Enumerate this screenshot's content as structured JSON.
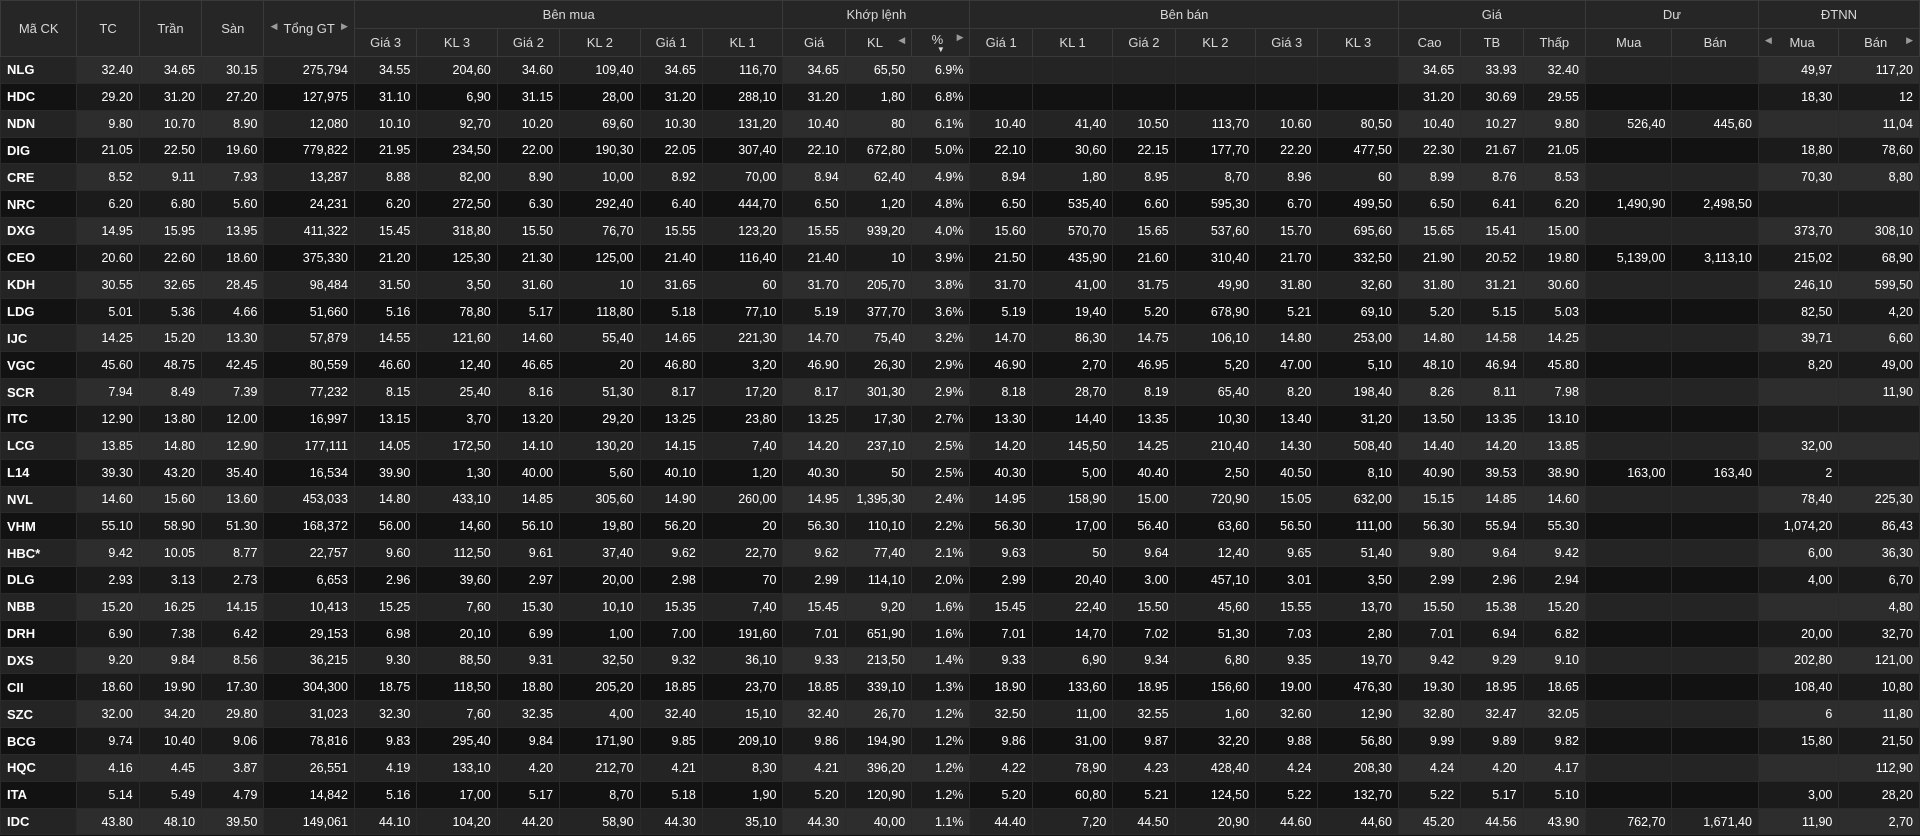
{
  "colors": {
    "ref": "#f5d10a",
    "ceil": "#e65bf5",
    "floor": "#4fd9f0",
    "up": "#1edc1e",
    "down": "#ff3b3b",
    "white": "#ffffff"
  },
  "header": {
    "symbol": "Mã CK",
    "ref": "TC",
    "ceil": "Trần",
    "floor": "Sàn",
    "total": "Tổng GT",
    "bid_group": "Bên mua",
    "match_group": "Khớp lệnh",
    "ask_group": "Bên bán",
    "price_group": "Giá",
    "rest_group": "Dư",
    "foreign_group": "ĐTNN",
    "bid_cols": [
      "Giá 3",
      "KL 3",
      "Giá 2",
      "KL 2",
      "Giá 1",
      "KL 1"
    ],
    "match_cols": [
      "Giá",
      "KL",
      "%"
    ],
    "ask_cols": [
      "Giá 1",
      "KL 1",
      "Giá 2",
      "KL 2",
      "Giá 3",
      "KL 3"
    ],
    "price_cols": [
      "Cao",
      "TB",
      "Thấp"
    ],
    "rest_cols": [
      "Mua",
      "Bán"
    ],
    "foreign_cols": [
      "Mua",
      "Bán"
    ]
  },
  "rows": [
    {
      "sym": "NLG",
      "tc": "32.40",
      "tran": "34.65",
      "san": "30.15",
      "gt": "275,794",
      "b3": "34.55",
      "bk3": "204,60",
      "b2": "34.60",
      "bk2": "109,40",
      "b1": "34.65",
      "bk1": "116,70",
      "mp": "34.65",
      "mk": "65,50",
      "pct": "6.9%",
      "a1": "",
      "ak1": "",
      "a2": "",
      "ak2": "",
      "a3": "",
      "ak3": "",
      "cao": "34.65",
      "tb": "33.93",
      "thap": "32.40",
      "dm": "",
      "db": "",
      "fm": "49,97",
      "fb": "117,20",
      "c": "cecceccccccccccccccxxxxxxcur"
    },
    {
      "sym": "HDC",
      "tc": "29.20",
      "tran": "31.20",
      "san": "27.20",
      "gt": "127,975",
      "b3": "31.10",
      "bk3": "6,90",
      "b2": "31.15",
      "bk2": "28,00",
      "b1": "31.20",
      "bk1": "288,10",
      "mp": "31.20",
      "mk": "1,80",
      "pct": "6.8%",
      "a1": "",
      "ak1": "",
      "a2": "",
      "ak2": "",
      "a3": "",
      "ak3": "",
      "cao": "31.20",
      "tb": "30.69",
      "thap": "29.55",
      "dm": "",
      "db": "",
      "fm": "18,30",
      "fb": "12",
      "c": "crcfwuuuucccccccxxxxxxcuu"
    },
    {
      "sym": "NDN",
      "tc": "9.80",
      "tran": "10.70",
      "san": "8.90",
      "gt": "12,080",
      "b3": "10.10",
      "bk3": "92,70",
      "b2": "10.20",
      "bk2": "69,60",
      "b1": "10.30",
      "bk1": "131,20",
      "mp": "10.40",
      "mk": "80",
      "pct": "6.1%",
      "a1": "10.40",
      "ak1": "41,40",
      "a2": "10.50",
      "ak2": "113,70",
      "a3": "10.60",
      "ak3": "80,50",
      "cao": "10.40",
      "tb": "10.27",
      "thap": "9.80",
      "dm": "526,40",
      "db": "445,60",
      "fm": "",
      "fb": "11,04",
      "c": "u"
    },
    {
      "sym": "DIG",
      "tc": "21.05",
      "tran": "22.50",
      "san": "19.60",
      "gt": "779,822",
      "b3": "21.95",
      "bk3": "234,50",
      "b2": "22.00",
      "bk2": "190,30",
      "b1": "22.05",
      "bk1": "307,40",
      "mp": "22.10",
      "mk": "672,80",
      "pct": "5.0%",
      "a1": "22.10",
      "ak1": "30,60",
      "a2": "22.15",
      "ak2": "177,70",
      "a3": "22.20",
      "ak3": "477,50",
      "cao": "22.30",
      "tb": "21.67",
      "thap": "21.05",
      "dm": "",
      "db": "",
      "fm": "18,80",
      "fb": "78,60",
      "c": "u"
    },
    {
      "sym": "CRE",
      "tc": "8.52",
      "tran": "9.11",
      "san": "7.93",
      "gt": "13,287",
      "b3": "8.88",
      "bk3": "82,00",
      "b2": "8.90",
      "bk2": "10,00",
      "b1": "8.92",
      "bk1": "70,00",
      "mp": "8.94",
      "mk": "62,40",
      "pct": "4.9%",
      "a1": "8.94",
      "ak1": "1,80",
      "a2": "8.95",
      "ak2": "8,70",
      "a3": "8.96",
      "ak3": "60",
      "cao": "8.99",
      "tb": "8.76",
      "thap": "8.53",
      "dm": "",
      "db": "",
      "fm": "70,30",
      "fb": "8,80",
      "c": "u"
    },
    {
      "sym": "NRC",
      "tc": "6.20",
      "tran": "6.80",
      "san": "5.60",
      "gt": "24,231",
      "b3": "6.20",
      "bk3": "272,50",
      "b2": "6.30",
      "bk2": "292,40",
      "b1": "6.40",
      "bk1": "444,70",
      "mp": "6.50",
      "mk": "1,20",
      "pct": "4.8%",
      "a1": "6.50",
      "ak1": "535,40",
      "a2": "6.60",
      "ak2": "595,30",
      "a3": "6.70",
      "ak3": "499,50",
      "cao": "6.50",
      "tb": "6.41",
      "thap": "6.20",
      "dm": "1,490,90",
      "db": "2,498,50",
      "fm": "",
      "fb": "",
      "c": "u",
      "b3c": "ref",
      "bk3c": "ref",
      "thapc": "ref"
    },
    {
      "sym": "DXG",
      "tc": "14.95",
      "tran": "15.95",
      "san": "13.95",
      "gt": "411,322",
      "b3": "15.45",
      "bk3": "318,80",
      "b2": "15.50",
      "bk2": "76,70",
      "b1": "15.55",
      "bk1": "123,20",
      "mp": "15.55",
      "mk": "939,20",
      "pct": "4.0%",
      "a1": "15.60",
      "ak1": "570,70",
      "a2": "15.65",
      "ak2": "537,60",
      "a3": "15.70",
      "ak3": "695,60",
      "cao": "15.65",
      "tb": "15.41",
      "thap": "15.00",
      "dm": "",
      "db": "",
      "fm": "373,70",
      "fb": "308,10",
      "c": "u"
    },
    {
      "sym": "CEO",
      "tc": "20.60",
      "tran": "22.60",
      "san": "18.60",
      "gt": "375,330",
      "b3": "21.20",
      "bk3": "125,30",
      "b2": "21.30",
      "bk2": "125,00",
      "b1": "21.40",
      "bk1": "116,40",
      "mp": "21.40",
      "mk": "10",
      "pct": "3.9%",
      "a1": "21.50",
      "ak1": "435,90",
      "a2": "21.60",
      "ak2": "310,40",
      "a3": "21.70",
      "ak3": "332,50",
      "cao": "21.90",
      "tb": "20.52",
      "thap": "19.80",
      "dm": "5,139,00",
      "db": "3,113,10",
      "fm": "215,02",
      "fb": "68,90",
      "c": "u",
      "tbc": "down",
      "thapc": "down"
    },
    {
      "sym": "KDH",
      "tc": "30.55",
      "tran": "32.65",
      "san": "28.45",
      "gt": "98,484",
      "b3": "31.50",
      "bk3": "3,50",
      "b2": "31.60",
      "bk2": "10",
      "b1": "31.65",
      "bk1": "60",
      "mp": "31.70",
      "mk": "205,70",
      "pct": "3.8%",
      "a1": "31.70",
      "ak1": "41,00",
      "a2": "31.75",
      "ak2": "49,90",
      "a3": "31.80",
      "ak3": "32,60",
      "cao": "31.80",
      "tb": "31.21",
      "thap": "30.60",
      "dm": "",
      "db": "",
      "fm": "246,10",
      "fb": "599,50",
      "c": "u"
    },
    {
      "sym": "LDG",
      "tc": "5.01",
      "tran": "5.36",
      "san": "4.66",
      "gt": "51,660",
      "b3": "5.16",
      "bk3": "78,80",
      "b2": "5.17",
      "bk2": "118,80",
      "b1": "5.18",
      "bk1": "77,10",
      "mp": "5.19",
      "mk": "377,70",
      "pct": "3.6%",
      "a1": "5.19",
      "ak1": "19,40",
      "a2": "5.20",
      "ak2": "678,90",
      "a3": "5.21",
      "ak3": "69,10",
      "cao": "5.20",
      "tb": "5.15",
      "thap": "5.03",
      "dm": "",
      "db": "",
      "fm": "82,50",
      "fb": "4,20",
      "c": "u"
    },
    {
      "sym": "IJC",
      "tc": "14.25",
      "tran": "15.20",
      "san": "13.30",
      "gt": "57,879",
      "b3": "14.55",
      "bk3": "121,60",
      "b2": "14.60",
      "bk2": "55,40",
      "b1": "14.65",
      "bk1": "221,30",
      "mp": "14.70",
      "mk": "75,40",
      "pct": "3.2%",
      "a1": "14.70",
      "ak1": "86,30",
      "a2": "14.75",
      "ak2": "106,10",
      "a3": "14.80",
      "ak3": "253,00",
      "cao": "14.80",
      "tb": "14.58",
      "thap": "14.25",
      "dm": "",
      "db": "",
      "fm": "39,71",
      "fb": "6,60",
      "c": "u",
      "thapc": "ref"
    },
    {
      "sym": "VGC",
      "tc": "45.60",
      "tran": "48.75",
      "san": "42.45",
      "gt": "80,559",
      "b3": "46.60",
      "bk3": "12,40",
      "b2": "46.65",
      "bk2": "20",
      "b1": "46.80",
      "bk1": "3,20",
      "mp": "46.90",
      "mk": "26,30",
      "pct": "2.9%",
      "a1": "46.90",
      "ak1": "2,70",
      "a2": "46.95",
      "ak2": "5,20",
      "a3": "47.00",
      "ak3": "5,10",
      "cao": "48.10",
      "tb": "46.94",
      "thap": "45.80",
      "dm": "",
      "db": "",
      "fm": "8,20",
      "fb": "49,00",
      "c": "u"
    },
    {
      "sym": "SCR",
      "tc": "7.94",
      "tran": "8.49",
      "san": "7.39",
      "gt": "77,232",
      "b3": "8.15",
      "bk3": "25,40",
      "b2": "8.16",
      "bk2": "51,30",
      "b1": "8.17",
      "bk1": "17,20",
      "mp": "8.17",
      "mk": "301,30",
      "pct": "2.9%",
      "a1": "8.18",
      "ak1": "28,70",
      "a2": "8.19",
      "ak2": "65,40",
      "a3": "8.20",
      "ak3": "198,40",
      "cao": "8.26",
      "tb": "8.11",
      "thap": "7.98",
      "dm": "",
      "db": "",
      "fm": "",
      "fb": "11,90",
      "c": "u"
    },
    {
      "sym": "ITC",
      "tc": "12.90",
      "tran": "13.80",
      "san": "12.00",
      "gt": "16,997",
      "b3": "13.15",
      "bk3": "3,70",
      "b2": "13.20",
      "bk2": "29,20",
      "b1": "13.25",
      "bk1": "23,80",
      "mp": "13.25",
      "mk": "17,30",
      "pct": "2.7%",
      "a1": "13.30",
      "ak1": "14,40",
      "a2": "13.35",
      "ak2": "10,30",
      "a3": "13.40",
      "ak3": "31,20",
      "cao": "13.50",
      "tb": "13.35",
      "thap": "13.10",
      "dm": "",
      "db": "",
      "fm": "",
      "fb": "",
      "c": "u"
    },
    {
      "sym": "LCG",
      "tc": "13.85",
      "tran": "14.80",
      "san": "12.90",
      "gt": "177,111",
      "b3": "14.05",
      "bk3": "172,50",
      "b2": "14.10",
      "bk2": "130,20",
      "b1": "14.15",
      "bk1": "7,40",
      "mp": "14.20",
      "mk": "237,10",
      "pct": "2.5%",
      "a1": "14.20",
      "ak1": "145,50",
      "a2": "14.25",
      "ak2": "210,40",
      "a3": "14.30",
      "ak3": "508,40",
      "cao": "14.40",
      "tb": "14.20",
      "thap": "13.85",
      "dm": "",
      "db": "",
      "fm": "32,00",
      "fb": "",
      "c": "u",
      "thapc": "ref"
    },
    {
      "sym": "L14",
      "tc": "39.30",
      "tran": "43.20",
      "san": "35.40",
      "gt": "16,534",
      "b3": "39.90",
      "bk3": "1,30",
      "b2": "40.00",
      "bk2": "5,60",
      "b1": "40.10",
      "bk1": "1,20",
      "mp": "40.30",
      "mk": "50",
      "pct": "2.5%",
      "a1": "40.30",
      "ak1": "5,00",
      "a2": "40.40",
      "ak2": "2,50",
      "a3": "40.50",
      "ak3": "8,10",
      "cao": "40.90",
      "tb": "39.53",
      "thap": "38.90",
      "dm": "163,00",
      "db": "163,40",
      "fm": "2",
      "fb": "",
      "c": "u",
      "thapc": "down"
    },
    {
      "sym": "NVL",
      "tc": "14.60",
      "tran": "15.60",
      "san": "13.60",
      "gt": "453,033",
      "b3": "14.80",
      "bk3": "433,10",
      "b2": "14.85",
      "bk2": "305,60",
      "b1": "14.90",
      "bk1": "260,00",
      "mp": "14.95",
      "mk": "1,395,30",
      "pct": "2.4%",
      "a1": "14.95",
      "ak1": "158,90",
      "a2": "15.00",
      "ak2": "720,90",
      "a3": "15.05",
      "ak3": "632,00",
      "cao": "15.15",
      "tb": "14.85",
      "thap": "14.60",
      "dm": "",
      "db": "",
      "fm": "78,40",
      "fb": "225,30",
      "c": "u",
      "thapc": "ref"
    },
    {
      "sym": "VHM",
      "tc": "55.10",
      "tran": "58.90",
      "san": "51.30",
      "gt": "168,372",
      "b3": "56.00",
      "bk3": "14,60",
      "b2": "56.10",
      "bk2": "19,80",
      "b1": "56.20",
      "bk1": "20",
      "mp": "56.30",
      "mk": "110,10",
      "pct": "2.2%",
      "a1": "56.30",
      "ak1": "17,00",
      "a2": "56.40",
      "ak2": "63,60",
      "a3": "56.50",
      "ak3": "111,00",
      "cao": "56.30",
      "tb": "55.94",
      "thap": "55.30",
      "dm": "",
      "db": "",
      "fm": "1,074,20",
      "fb": "86,43",
      "c": "u"
    },
    {
      "sym": "HBC*",
      "tc": "9.42",
      "tran": "10.05",
      "san": "8.77",
      "gt": "22,757",
      "b3": "9.60",
      "bk3": "112,50",
      "b2": "9.61",
      "bk2": "37,40",
      "b1": "9.62",
      "bk1": "22,70",
      "mp": "9.62",
      "mk": "77,40",
      "pct": "2.1%",
      "a1": "9.63",
      "ak1": "50",
      "a2": "9.64",
      "ak2": "12,40",
      "a3": "9.65",
      "ak3": "51,40",
      "cao": "9.80",
      "tb": "9.64",
      "thap": "9.42",
      "dm": "",
      "db": "",
      "fm": "6,00",
      "fb": "36,30",
      "c": "u",
      "thapc": "ref"
    },
    {
      "sym": "DLG",
      "tc": "2.93",
      "tran": "3.13",
      "san": "2.73",
      "gt": "6,653",
      "b3": "2.96",
      "bk3": "39,60",
      "b2": "2.97",
      "bk2": "20,00",
      "b1": "2.98",
      "bk1": "70",
      "mp": "2.99",
      "mk": "114,10",
      "pct": "2.0%",
      "a1": "2.99",
      "ak1": "20,40",
      "a2": "3.00",
      "ak2": "457,10",
      "a3": "3.01",
      "ak3": "3,50",
      "cao": "2.99",
      "tb": "2.96",
      "thap": "2.94",
      "dm": "",
      "db": "",
      "fm": "4,00",
      "fb": "6,70",
      "c": "u"
    },
    {
      "sym": "NBB",
      "tc": "15.20",
      "tran": "16.25",
      "san": "14.15",
      "gt": "10,413",
      "b3": "15.25",
      "bk3": "7,60",
      "b2": "15.30",
      "bk2": "10,10",
      "b1": "15.35",
      "bk1": "7,40",
      "mp": "15.45",
      "mk": "9,20",
      "pct": "1.6%",
      "a1": "15.45",
      "ak1": "22,40",
      "a2": "15.50",
      "ak2": "45,60",
      "a3": "15.55",
      "ak3": "13,70",
      "cao": "15.50",
      "tb": "15.38",
      "thap": "15.20",
      "dm": "",
      "db": "",
      "fm": "",
      "fb": "4,80",
      "c": "u",
      "thapc": "ref"
    },
    {
      "sym": "DRH",
      "tc": "6.90",
      "tran": "7.38",
      "san": "6.42",
      "gt": "29,153",
      "b3": "6.98",
      "bk3": "20,10",
      "b2": "6.99",
      "bk2": "1,00",
      "b1": "7.00",
      "bk1": "191,60",
      "mp": "7.01",
      "mk": "651,90",
      "pct": "1.6%",
      "a1": "7.01",
      "ak1": "14,70",
      "a2": "7.02",
      "ak2": "51,30",
      "a3": "7.03",
      "ak3": "2,80",
      "cao": "7.01",
      "tb": "6.94",
      "thap": "6.82",
      "dm": "",
      "db": "",
      "fm": "20,00",
      "fb": "32,70",
      "c": "u",
      "thapc": "down"
    },
    {
      "sym": "DXS",
      "tc": "9.20",
      "tran": "9.84",
      "san": "8.56",
      "gt": "36,215",
      "b3": "9.30",
      "bk3": "88,50",
      "b2": "9.31",
      "bk2": "32,50",
      "b1": "9.32",
      "bk1": "36,10",
      "mp": "9.33",
      "mk": "213,50",
      "pct": "1.4%",
      "a1": "9.33",
      "ak1": "6,90",
      "a2": "9.34",
      "ak2": "6,80",
      "a3": "9.35",
      "ak3": "19,70",
      "cao": "9.42",
      "tb": "9.29",
      "thap": "9.10",
      "dm": "",
      "db": "",
      "fm": "202,80",
      "fb": "121,00",
      "c": "u",
      "thapc": "down"
    },
    {
      "sym": "CII",
      "tc": "18.60",
      "tran": "19.90",
      "san": "17.30",
      "gt": "304,300",
      "b3": "18.75",
      "bk3": "118,50",
      "b2": "18.80",
      "bk2": "205,20",
      "b1": "18.85",
      "bk1": "23,70",
      "mp": "18.85",
      "mk": "339,10",
      "pct": "1.3%",
      "a1": "18.90",
      "ak1": "133,60",
      "a2": "18.95",
      "ak2": "156,60",
      "a3": "19.00",
      "ak3": "476,30",
      "cao": "19.30",
      "tb": "18.95",
      "thap": "18.65",
      "dm": "",
      "db": "",
      "fm": "108,40",
      "fb": "10,80",
      "c": "u"
    },
    {
      "sym": "SZC",
      "tc": "32.00",
      "tran": "34.20",
      "san": "29.80",
      "gt": "31,023",
      "b3": "32.30",
      "bk3": "7,60",
      "b2": "32.35",
      "bk2": "4,00",
      "b1": "32.40",
      "bk1": "15,10",
      "mp": "32.40",
      "mk": "26,70",
      "pct": "1.2%",
      "a1": "32.50",
      "ak1": "11,00",
      "a2": "32.55",
      "ak2": "1,60",
      "a3": "32.60",
      "ak3": "12,90",
      "cao": "32.80",
      "tb": "32.47",
      "thap": "32.05",
      "dm": "",
      "db": "",
      "fm": "6",
      "fb": "11,80",
      "c": "u"
    },
    {
      "sym": "BCG",
      "tc": "9.74",
      "tran": "10.40",
      "san": "9.06",
      "gt": "78,816",
      "b3": "9.83",
      "bk3": "295,40",
      "b2": "9.84",
      "bk2": "171,90",
      "b1": "9.85",
      "bk1": "209,10",
      "mp": "9.86",
      "mk": "194,90",
      "pct": "1.2%",
      "a1": "9.86",
      "ak1": "31,00",
      "a2": "9.87",
      "ak2": "32,20",
      "a3": "9.88",
      "ak3": "56,80",
      "cao": "9.99",
      "tb": "9.89",
      "thap": "9.82",
      "dm": "",
      "db": "",
      "fm": "15,80",
      "fb": "21,50",
      "c": "u"
    },
    {
      "sym": "HQC",
      "tc": "4.16",
      "tran": "4.45",
      "san": "3.87",
      "gt": "26,551",
      "b3": "4.19",
      "bk3": "133,10",
      "b2": "4.20",
      "bk2": "212,70",
      "b1": "4.21",
      "bk1": "8,30",
      "mp": "4.21",
      "mk": "396,20",
      "pct": "1.2%",
      "a1": "4.22",
      "ak1": "78,90",
      "a2": "4.23",
      "ak2": "428,40",
      "a3": "4.24",
      "ak3": "208,30",
      "cao": "4.24",
      "tb": "4.20",
      "thap": "4.17",
      "dm": "",
      "db": "",
      "fm": "",
      "fb": "112,90",
      "c": "u"
    },
    {
      "sym": "ITA",
      "tc": "5.14",
      "tran": "5.49",
      "san": "4.79",
      "gt": "14,842",
      "b3": "5.16",
      "bk3": "17,00",
      "b2": "5.17",
      "bk2": "8,70",
      "b1": "5.18",
      "bk1": "1,90",
      "mp": "5.20",
      "mk": "120,90",
      "pct": "1.2%",
      "a1": "5.20",
      "ak1": "60,80",
      "a2": "5.21",
      "ak2": "124,50",
      "a3": "5.22",
      "ak3": "132,70",
      "cao": "5.22",
      "tb": "5.17",
      "thap": "5.10",
      "dm": "",
      "db": "",
      "fm": "3,00",
      "fb": "28,20",
      "c": "u",
      "thapc": "down"
    },
    {
      "sym": "IDC",
      "tc": "43.80",
      "tran": "48.10",
      "san": "39.50",
      "gt": "149,061",
      "b3": "44.10",
      "bk3": "104,20",
      "b2": "44.20",
      "bk2": "58,90",
      "b1": "44.30",
      "bk1": "35,10",
      "mp": "44.30",
      "mk": "40,00",
      "pct": "1.1%",
      "a1": "44.40",
      "ak1": "7,20",
      "a2": "44.50",
      "ak2": "20,90",
      "a3": "44.60",
      "ak3": "44,60",
      "cao": "45.20",
      "tb": "44.56",
      "thap": "43.90",
      "dm": "762,70",
      "db": "1,671,40",
      "fm": "11,90",
      "fb": "2,70",
      "c": "u"
    }
  ]
}
